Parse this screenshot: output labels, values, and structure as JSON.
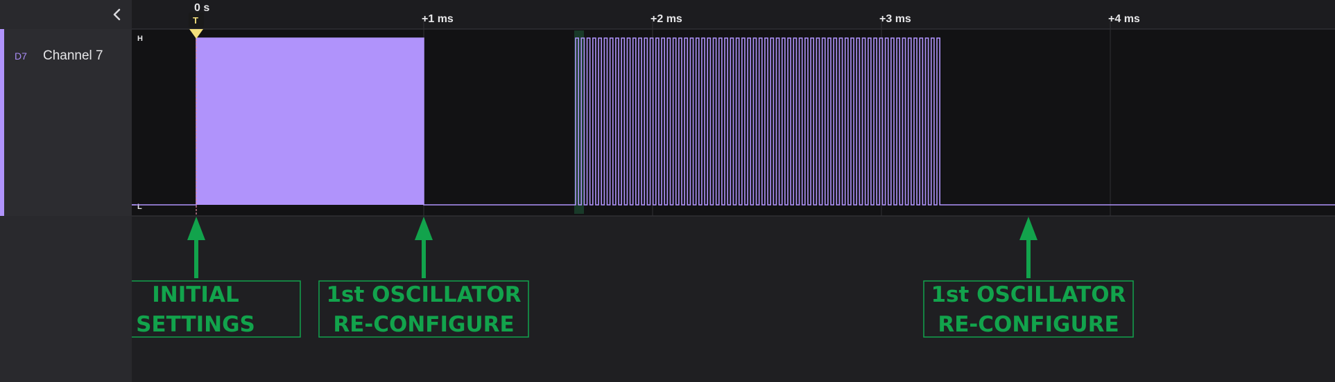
{
  "channel": {
    "id": "D7",
    "name": "Channel 7",
    "color": "#b093fb"
  },
  "timeline": {
    "origin_label": "0 s",
    "trigger_label": "T",
    "ticks": [
      "+1 ms",
      "+2 ms",
      "+3 ms",
      "+4 ms"
    ]
  },
  "levels": {
    "high": "H",
    "low": "L"
  },
  "annotations": [
    {
      "lines": [
        "INITIAL",
        "SETTINGS"
      ]
    },
    {
      "lines": [
        "1st OSCILLATOR",
        "RE-CONFIGURE"
      ]
    },
    {
      "lines": [
        "1st OSCILLATOR",
        "RE-CONFIGURE"
      ]
    }
  ],
  "colors": {
    "annotation": "#12a34c",
    "trigger": "#f3df7c",
    "panel": "#29292d",
    "waveform_bg": "#121214"
  },
  "icons": {
    "collapse": "chevron-left-icon",
    "trigger": "trigger-marker-icon"
  }
}
